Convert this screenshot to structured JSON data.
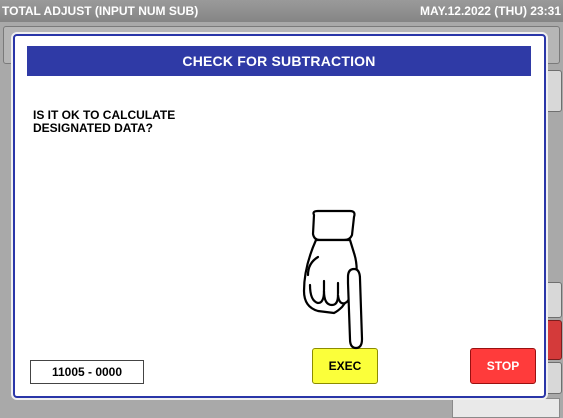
{
  "header": {
    "title": "TOTAL ADJUST (INPUT NUM SUB)",
    "datetime": "MAY.12.2022 (THU)  23:31"
  },
  "dialog": {
    "title": "CHECK FOR SUBTRACTION",
    "message_line1": "IS IT OK TO CALCULATE",
    "message_line2": "DESIGNATED DATA?",
    "code": "11005 - 0000",
    "exec_label": "EXEC",
    "stop_label": "STOP"
  },
  "icons": [
    "pointing-hand-icon"
  ],
  "colors": {
    "header_blue": "#2f3aa6",
    "exec_yellow": "#fbff3a",
    "stop_red": "#ff3b3b"
  }
}
